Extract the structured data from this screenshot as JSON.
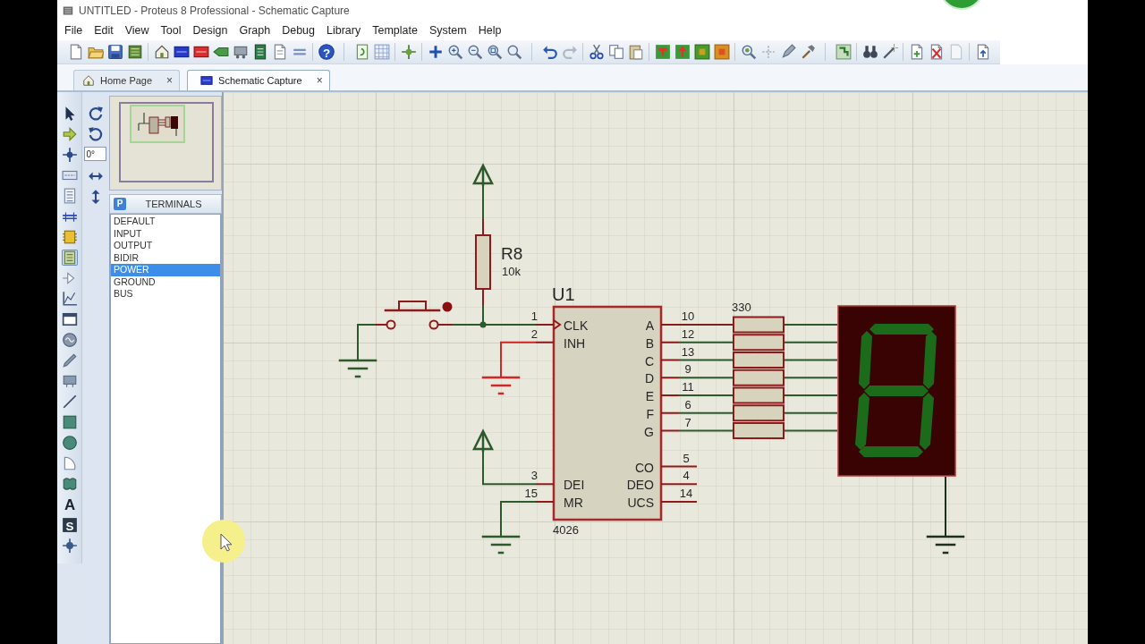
{
  "window": {
    "title": "UNTITLED - Proteus 8 Professional - Schematic Capture"
  },
  "menu": [
    "File",
    "Edit",
    "View",
    "Tool",
    "Design",
    "Graph",
    "Debug",
    "Library",
    "Template",
    "System",
    "Help"
  ],
  "toolbar": {
    "help_glyph": "?"
  },
  "tabs": [
    {
      "label": "Home Page",
      "selected": false,
      "close": "×"
    },
    {
      "label": "Schematic Capture",
      "selected": true,
      "close": "×"
    }
  ],
  "mode_tools": [
    {
      "kind": "select",
      "selected": false
    },
    {
      "kind": "component",
      "selected": false
    },
    {
      "kind": "junction",
      "selected": false
    },
    {
      "kind": "label",
      "selected": false
    },
    {
      "kind": "script",
      "selected": false
    },
    {
      "kind": "bus",
      "selected": false
    },
    {
      "kind": "subcircuit",
      "selected": false
    },
    {
      "kind": "terminal",
      "selected": true
    },
    {
      "kind": "pin",
      "selected": false
    },
    {
      "kind": "graph",
      "selected": false
    },
    {
      "kind": "tape",
      "selected": false
    },
    {
      "kind": "generator",
      "selected": false
    },
    {
      "kind": "probe",
      "selected": false
    },
    {
      "kind": "meter",
      "selected": false
    },
    {
      "kind": "line",
      "selected": false
    },
    {
      "kind": "box",
      "selected": false
    },
    {
      "kind": "circle",
      "selected": false
    },
    {
      "kind": "arc",
      "selected": false
    },
    {
      "kind": "path",
      "selected": false
    },
    {
      "kind": "text",
      "glyph": "A",
      "selected": false
    },
    {
      "kind": "symbol",
      "glyph": "S",
      "selected": false
    },
    {
      "kind": "marker",
      "selected": false
    }
  ],
  "orientation": {
    "angle": "0°"
  },
  "terminals": {
    "pick_glyph": "P",
    "title": "TERMINALS",
    "items": [
      {
        "label": "DEFAULT",
        "selected": false
      },
      {
        "label": "INPUT",
        "selected": false
      },
      {
        "label": "OUTPUT",
        "selected": false
      },
      {
        "label": "BIDIR",
        "selected": false
      },
      {
        "label": "POWER",
        "selected": true
      },
      {
        "label": "GROUND",
        "selected": false
      },
      {
        "label": "BUS",
        "selected": false
      }
    ]
  },
  "schematic": {
    "resistor": {
      "reference": "R8",
      "value": "10k"
    },
    "chip": {
      "reference": "U1",
      "part": "4026",
      "left_pins_top": [
        {
          "number": "1",
          "name": "CLK",
          "kind": "clock"
        },
        {
          "number": "2",
          "name": "INH",
          "kind": "plain"
        }
      ],
      "left_pins_bottom": [
        {
          "number": "3",
          "name": "DEI",
          "kind": "plain"
        },
        {
          "number": "15",
          "name": "MR",
          "kind": "plain"
        }
      ],
      "right_pins_top": [
        {
          "number": "10",
          "name": "A"
        },
        {
          "number": "12",
          "name": "B"
        },
        {
          "number": "13",
          "name": "C"
        },
        {
          "number": "9",
          "name": "D"
        },
        {
          "number": "11",
          "name": "E"
        },
        {
          "number": "6",
          "name": "F"
        },
        {
          "number": "7",
          "name": "G"
        }
      ],
      "right_pins_bottom": [
        {
          "number": "5",
          "name": "CO"
        },
        {
          "number": "4",
          "name": "DEO"
        },
        {
          "number": "14",
          "name": "UCS"
        }
      ]
    },
    "resistor_pack": {
      "value": "330"
    }
  }
}
